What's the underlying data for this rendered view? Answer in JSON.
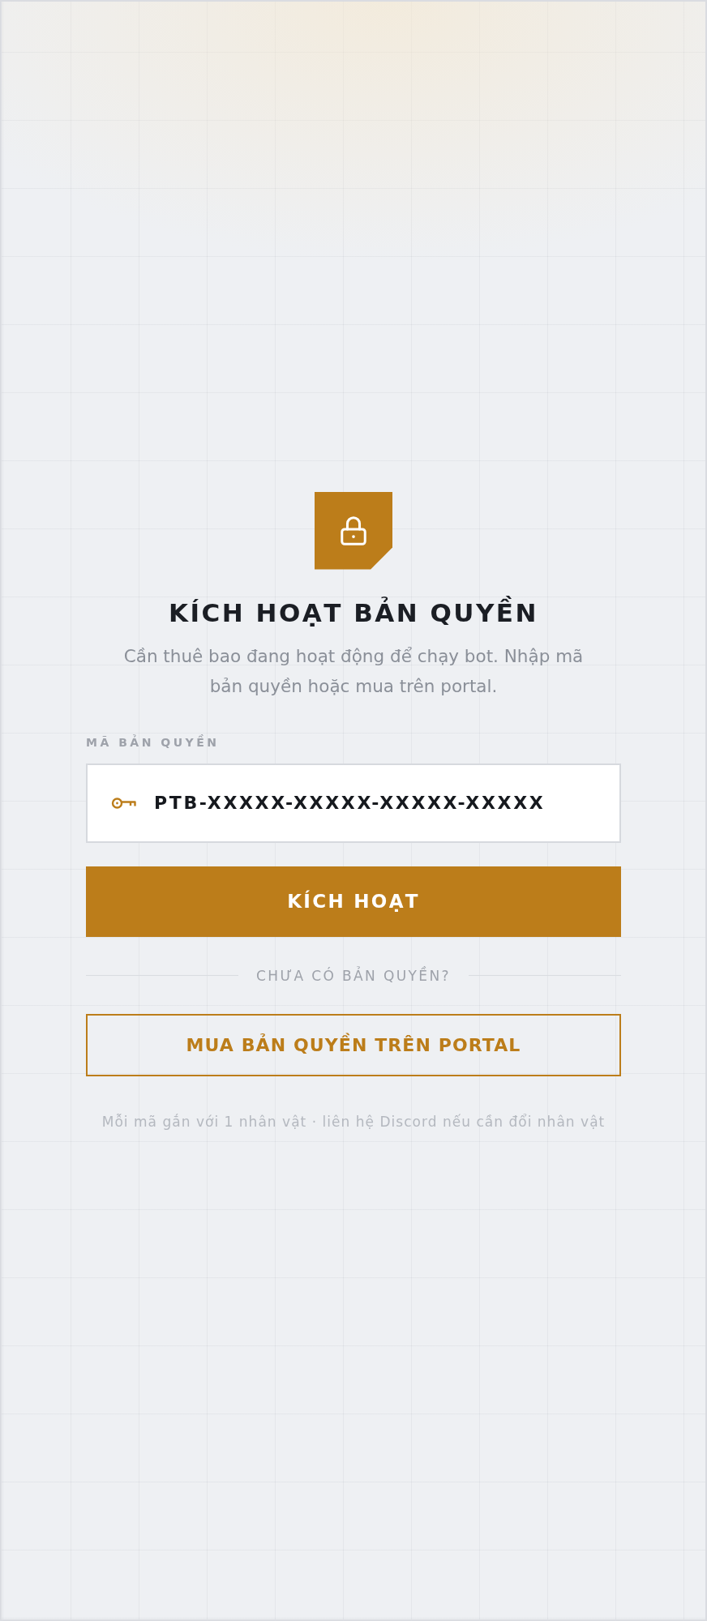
{
  "title": "KÍCH HOẠT BẢN QUYỀN",
  "subtitle": "Cần thuê bao đang hoạt động để chạy bot. Nhập mã bản quyền hoặc mua trên portal.",
  "license_field": {
    "label": "MÃ BẢN QUYỀN",
    "value": "PTB-XXXXX-XXXXX-XXXXX-XXXXX"
  },
  "activate_button": {
    "label": "KÍCH HOẠT"
  },
  "divider": {
    "label": "CHƯA CÓ BẢN QUYỀN?"
  },
  "portal_button": {
    "label": "MUA BẢN QUYỀN TRÊN PORTAL"
  },
  "footer_note": "Mỗi mã gắn với 1 nhân vật · liên hệ Discord nếu cần đổi nhân vật"
}
